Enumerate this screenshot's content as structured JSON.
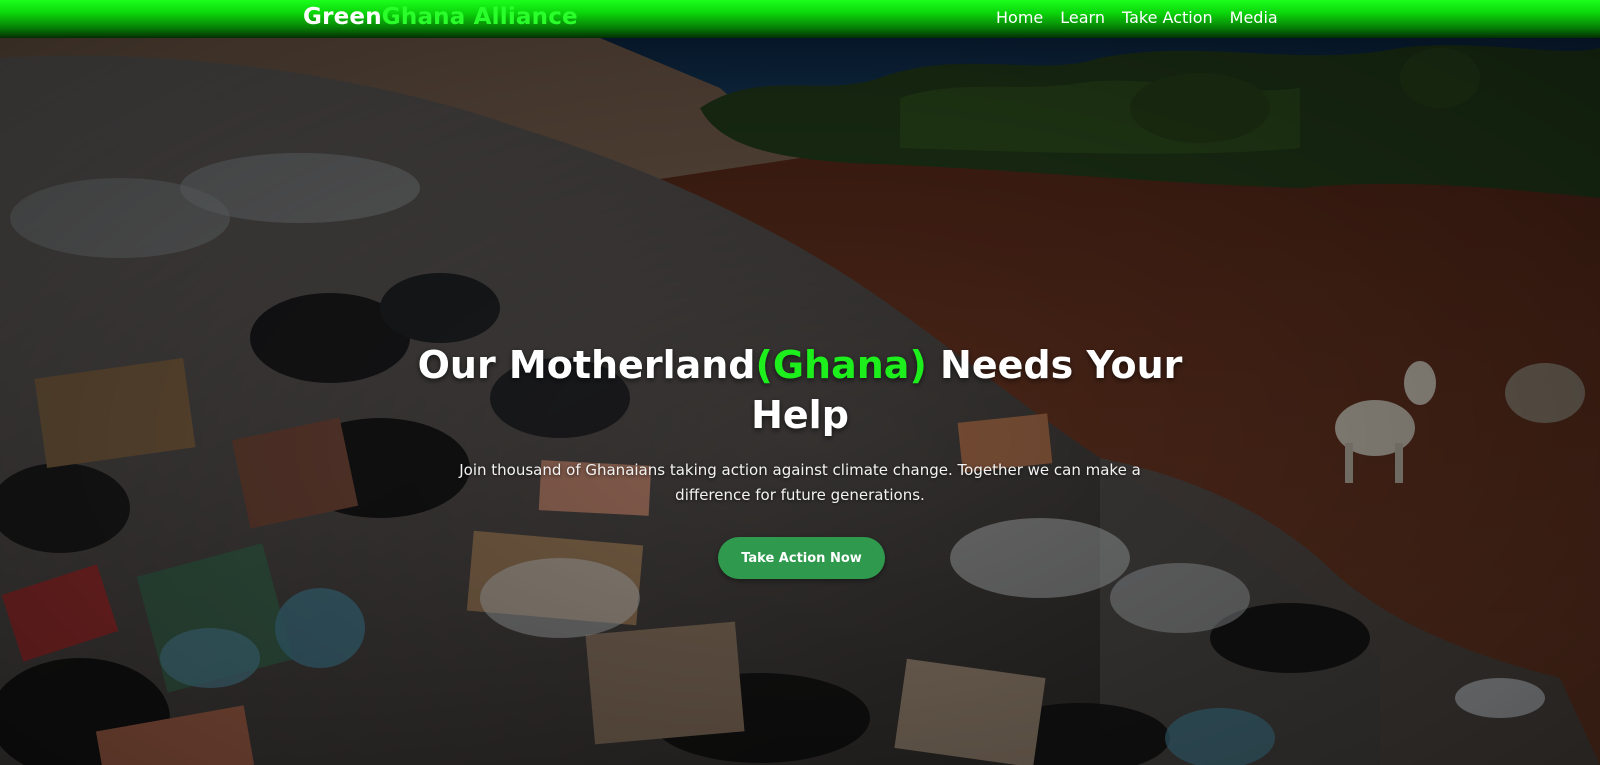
{
  "brand": {
    "part1": "Green",
    "part2": "Ghana Alliance"
  },
  "nav": {
    "items": [
      {
        "label": "Home"
      },
      {
        "label": "Learn"
      },
      {
        "label": "Take Action"
      },
      {
        "label": "Media"
      }
    ]
  },
  "hero": {
    "title_part1": "Our Motherland",
    "title_accent": "(Ghana)",
    "title_part2": " Needs Your Help",
    "subtitle": "Join thousand of Ghanaians taking action against climate change. Together we can make a difference for future generations.",
    "cta_label": "Take Action Now"
  },
  "colors": {
    "nav_green": "#0bd40b",
    "accent_green": "#1cef1c",
    "cta_green": "#2f9a4e"
  }
}
